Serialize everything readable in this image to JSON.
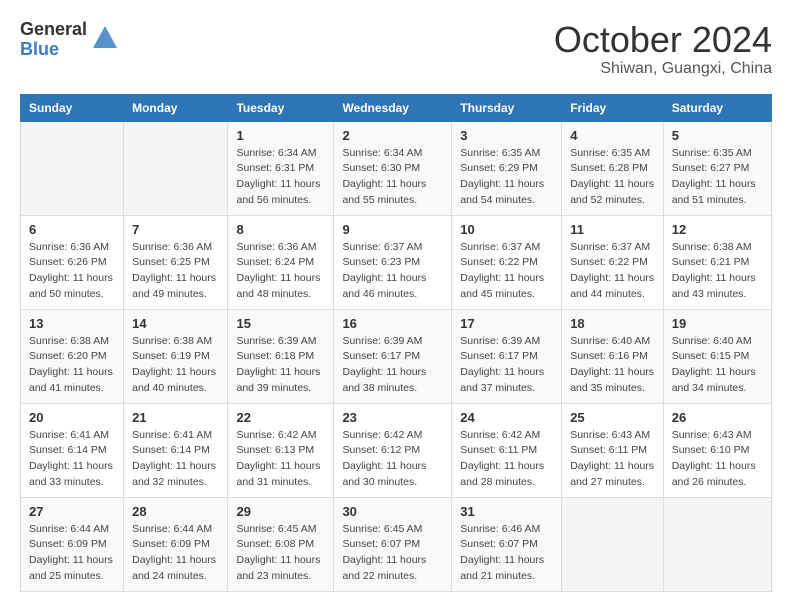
{
  "header": {
    "logo_general": "General",
    "logo_blue": "Blue",
    "month_title": "October 2024",
    "location": "Shiwan, Guangxi, China"
  },
  "weekdays": [
    "Sunday",
    "Monday",
    "Tuesday",
    "Wednesday",
    "Thursday",
    "Friday",
    "Saturday"
  ],
  "weeks": [
    [
      {
        "day": null
      },
      {
        "day": null
      },
      {
        "day": "1",
        "sunrise": "Sunrise: 6:34 AM",
        "sunset": "Sunset: 6:31 PM",
        "daylight": "Daylight: 11 hours and 56 minutes."
      },
      {
        "day": "2",
        "sunrise": "Sunrise: 6:34 AM",
        "sunset": "Sunset: 6:30 PM",
        "daylight": "Daylight: 11 hours and 55 minutes."
      },
      {
        "day": "3",
        "sunrise": "Sunrise: 6:35 AM",
        "sunset": "Sunset: 6:29 PM",
        "daylight": "Daylight: 11 hours and 54 minutes."
      },
      {
        "day": "4",
        "sunrise": "Sunrise: 6:35 AM",
        "sunset": "Sunset: 6:28 PM",
        "daylight": "Daylight: 11 hours and 52 minutes."
      },
      {
        "day": "5",
        "sunrise": "Sunrise: 6:35 AM",
        "sunset": "Sunset: 6:27 PM",
        "daylight": "Daylight: 11 hours and 51 minutes."
      }
    ],
    [
      {
        "day": "6",
        "sunrise": "Sunrise: 6:36 AM",
        "sunset": "Sunset: 6:26 PM",
        "daylight": "Daylight: 11 hours and 50 minutes."
      },
      {
        "day": "7",
        "sunrise": "Sunrise: 6:36 AM",
        "sunset": "Sunset: 6:25 PM",
        "daylight": "Daylight: 11 hours and 49 minutes."
      },
      {
        "day": "8",
        "sunrise": "Sunrise: 6:36 AM",
        "sunset": "Sunset: 6:24 PM",
        "daylight": "Daylight: 11 hours and 48 minutes."
      },
      {
        "day": "9",
        "sunrise": "Sunrise: 6:37 AM",
        "sunset": "Sunset: 6:23 PM",
        "daylight": "Daylight: 11 hours and 46 minutes."
      },
      {
        "day": "10",
        "sunrise": "Sunrise: 6:37 AM",
        "sunset": "Sunset: 6:22 PM",
        "daylight": "Daylight: 11 hours and 45 minutes."
      },
      {
        "day": "11",
        "sunrise": "Sunrise: 6:37 AM",
        "sunset": "Sunset: 6:22 PM",
        "daylight": "Daylight: 11 hours and 44 minutes."
      },
      {
        "day": "12",
        "sunrise": "Sunrise: 6:38 AM",
        "sunset": "Sunset: 6:21 PM",
        "daylight": "Daylight: 11 hours and 43 minutes."
      }
    ],
    [
      {
        "day": "13",
        "sunrise": "Sunrise: 6:38 AM",
        "sunset": "Sunset: 6:20 PM",
        "daylight": "Daylight: 11 hours and 41 minutes."
      },
      {
        "day": "14",
        "sunrise": "Sunrise: 6:38 AM",
        "sunset": "Sunset: 6:19 PM",
        "daylight": "Daylight: 11 hours and 40 minutes."
      },
      {
        "day": "15",
        "sunrise": "Sunrise: 6:39 AM",
        "sunset": "Sunset: 6:18 PM",
        "daylight": "Daylight: 11 hours and 39 minutes."
      },
      {
        "day": "16",
        "sunrise": "Sunrise: 6:39 AM",
        "sunset": "Sunset: 6:17 PM",
        "daylight": "Daylight: 11 hours and 38 minutes."
      },
      {
        "day": "17",
        "sunrise": "Sunrise: 6:39 AM",
        "sunset": "Sunset: 6:17 PM",
        "daylight": "Daylight: 11 hours and 37 minutes."
      },
      {
        "day": "18",
        "sunrise": "Sunrise: 6:40 AM",
        "sunset": "Sunset: 6:16 PM",
        "daylight": "Daylight: 11 hours and 35 minutes."
      },
      {
        "day": "19",
        "sunrise": "Sunrise: 6:40 AM",
        "sunset": "Sunset: 6:15 PM",
        "daylight": "Daylight: 11 hours and 34 minutes."
      }
    ],
    [
      {
        "day": "20",
        "sunrise": "Sunrise: 6:41 AM",
        "sunset": "Sunset: 6:14 PM",
        "daylight": "Daylight: 11 hours and 33 minutes."
      },
      {
        "day": "21",
        "sunrise": "Sunrise: 6:41 AM",
        "sunset": "Sunset: 6:14 PM",
        "daylight": "Daylight: 11 hours and 32 minutes."
      },
      {
        "day": "22",
        "sunrise": "Sunrise: 6:42 AM",
        "sunset": "Sunset: 6:13 PM",
        "daylight": "Daylight: 11 hours and 31 minutes."
      },
      {
        "day": "23",
        "sunrise": "Sunrise: 6:42 AM",
        "sunset": "Sunset: 6:12 PM",
        "daylight": "Daylight: 11 hours and 30 minutes."
      },
      {
        "day": "24",
        "sunrise": "Sunrise: 6:42 AM",
        "sunset": "Sunset: 6:11 PM",
        "daylight": "Daylight: 11 hours and 28 minutes."
      },
      {
        "day": "25",
        "sunrise": "Sunrise: 6:43 AM",
        "sunset": "Sunset: 6:11 PM",
        "daylight": "Daylight: 11 hours and 27 minutes."
      },
      {
        "day": "26",
        "sunrise": "Sunrise: 6:43 AM",
        "sunset": "Sunset: 6:10 PM",
        "daylight": "Daylight: 11 hours and 26 minutes."
      }
    ],
    [
      {
        "day": "27",
        "sunrise": "Sunrise: 6:44 AM",
        "sunset": "Sunset: 6:09 PM",
        "daylight": "Daylight: 11 hours and 25 minutes."
      },
      {
        "day": "28",
        "sunrise": "Sunrise: 6:44 AM",
        "sunset": "Sunset: 6:09 PM",
        "daylight": "Daylight: 11 hours and 24 minutes."
      },
      {
        "day": "29",
        "sunrise": "Sunrise: 6:45 AM",
        "sunset": "Sunset: 6:08 PM",
        "daylight": "Daylight: 11 hours and 23 minutes."
      },
      {
        "day": "30",
        "sunrise": "Sunrise: 6:45 AM",
        "sunset": "Sunset: 6:07 PM",
        "daylight": "Daylight: 11 hours and 22 minutes."
      },
      {
        "day": "31",
        "sunrise": "Sunrise: 6:46 AM",
        "sunset": "Sunset: 6:07 PM",
        "daylight": "Daylight: 11 hours and 21 minutes."
      },
      {
        "day": null
      },
      {
        "day": null
      }
    ]
  ]
}
